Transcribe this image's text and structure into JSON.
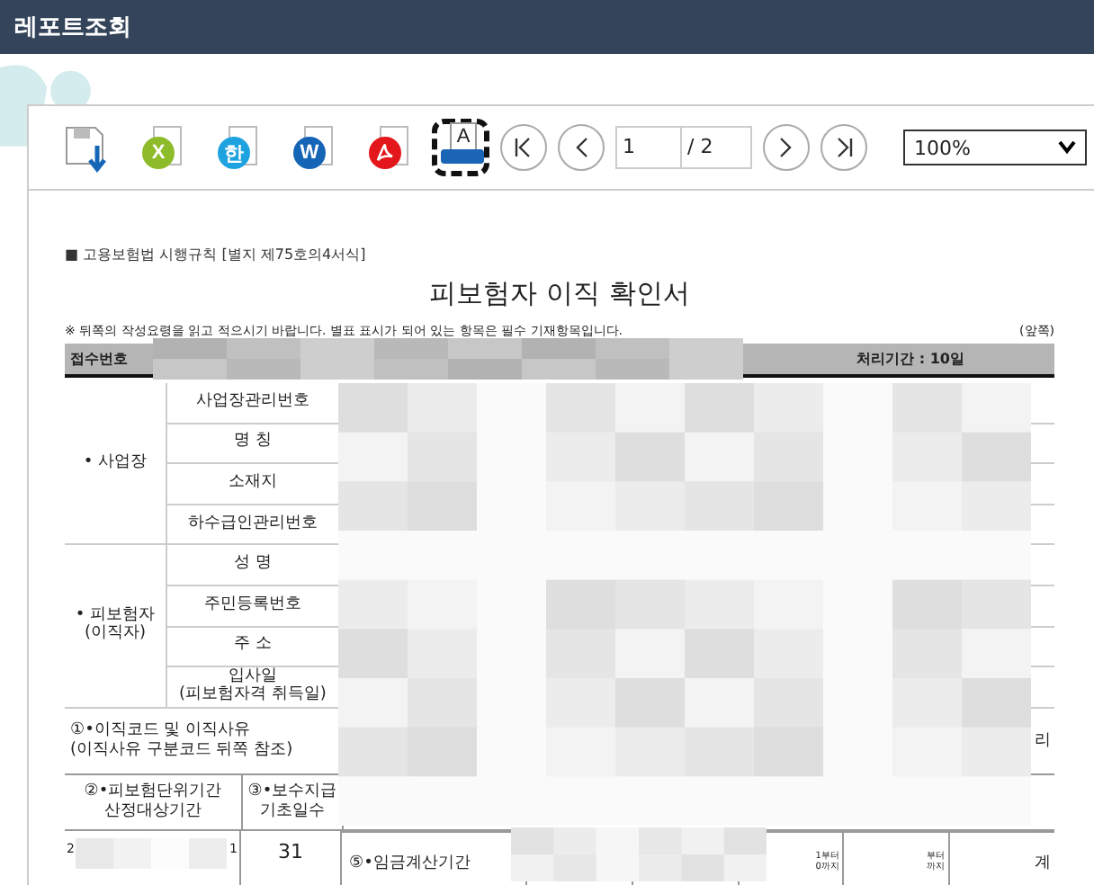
{
  "window": {
    "title": "레포트조회"
  },
  "toolbar": {
    "buttons": [
      {
        "kind": "save",
        "focused": false
      },
      {
        "kind": "excel",
        "glyph": "X",
        "focused": false
      },
      {
        "kind": "hwp",
        "glyph": "한",
        "focused": false
      },
      {
        "kind": "word",
        "glyph": "W",
        "focused": false
      },
      {
        "kind": "pdf",
        "focused": false
      },
      {
        "kind": "print",
        "glyph": "A",
        "focused": true
      }
    ],
    "nav": [
      {
        "kind": "first"
      },
      {
        "kind": "prev"
      }
    ],
    "page": "1",
    "page_total": "/ 2",
    "nav_after": [
      {
        "kind": "next"
      },
      {
        "kind": "last"
      }
    ],
    "zoom": "100%"
  },
  "report": {
    "form_ref": "■ 고용보험법 시행규칙 [별지 제75호의4서식]",
    "title": "피보험자 이직 확인서",
    "notice": "※ 뒤쪽의 작성요령을 읽고 적으시기 바랍니다. 별표 표시가 되어 있는 항목은 필수 기재항목입니다.",
    "side": "(앞쪽)",
    "header": {
      "left": "접수번호",
      "right": "처리기간 : 10일"
    },
    "sections": [
      {
        "label": "• 사업장",
        "fields": [
          "사업장관리번호",
          "명 칭",
          "소재지",
          "하수급인관리번호"
        ]
      },
      {
        "label": "• 피보험자\n(이직자)",
        "fields": [
          "성 명",
          "주민등록번호",
          "주 소",
          "입사일\n(피보험자격 취득일)"
        ]
      }
    ],
    "reason_label": "①•이직코드 및 이직사유\n(이직사유 구분코드 뒤쪽 참조)",
    "reason_tail": "리",
    "period_header": [
      "②•피보험단위기간\n산정대상기간",
      "③•보수지급\n기초일수"
    ],
    "period_row": {
      "start_fragment": "2",
      "end_fragment": "1",
      "days": "31"
    },
    "wage": {
      "label": "⑤•임금계산기간",
      "cells": [
        "1부터\n0까지",
        "부터\n까지",
        "계"
      ]
    }
  }
}
